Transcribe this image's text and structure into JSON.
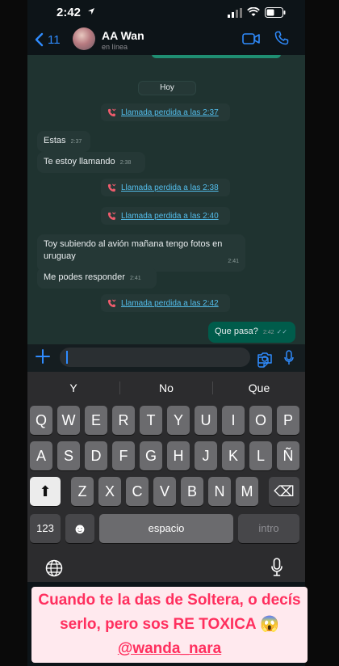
{
  "status_bar": {
    "time": "2:42"
  },
  "header": {
    "back_count": "11",
    "contact_name": "AA Wan",
    "contact_status": "en línea"
  },
  "chat": {
    "date_chip": "Hoy",
    "messages": [
      {
        "type": "missed",
        "text": "Llamada perdida a las 2:37"
      },
      {
        "type": "in",
        "text": "Estas",
        "time": "2:37"
      },
      {
        "type": "in",
        "text": "Te estoy llamando",
        "time": "2:38"
      },
      {
        "type": "missed",
        "text": "Llamada perdida a las 2:38"
      },
      {
        "type": "missed",
        "text": "Llamada perdida a las 2:40"
      },
      {
        "type": "in",
        "text": "Toy subiendo al avión mañana tengo fotos en uruguay",
        "time": "2:41"
      },
      {
        "type": "in",
        "text": "Me podes responder",
        "time": "2:41"
      },
      {
        "type": "missed",
        "text": "Llamada perdida a las 2:42"
      },
      {
        "type": "out",
        "text": "Que pasa?",
        "time": "2:42",
        "tick": "✓✓"
      }
    ]
  },
  "keyboard": {
    "suggestions": [
      "Y",
      "No",
      "Que"
    ],
    "row1": [
      "Q",
      "W",
      "E",
      "R",
      "T",
      "Y",
      "U",
      "I",
      "O",
      "P"
    ],
    "row2": [
      "A",
      "S",
      "D",
      "F",
      "G",
      "H",
      "J",
      "K",
      "L",
      "Ñ"
    ],
    "row3": [
      "Z",
      "X",
      "C",
      "V",
      "B",
      "N",
      "M"
    ],
    "numbers_label": "123",
    "emoji_label": "☻",
    "space_label": "espacio",
    "return_label": "intro",
    "shift_label": "⬆",
    "delete_label": "⌫"
  },
  "caption": {
    "line1": "Cuando te la das de Soltera, o decís",
    "line2": "serlo, pero sos RE TOXICA 😱",
    "mention": "@wanda_nara"
  },
  "colors": {
    "accent_blue": "#2f8bfd",
    "link_blue": "#53bdeb",
    "missed_red": "#f15c6d",
    "outgoing_bubble": "#005c4b",
    "caption_text": "#ff2f5e"
  }
}
